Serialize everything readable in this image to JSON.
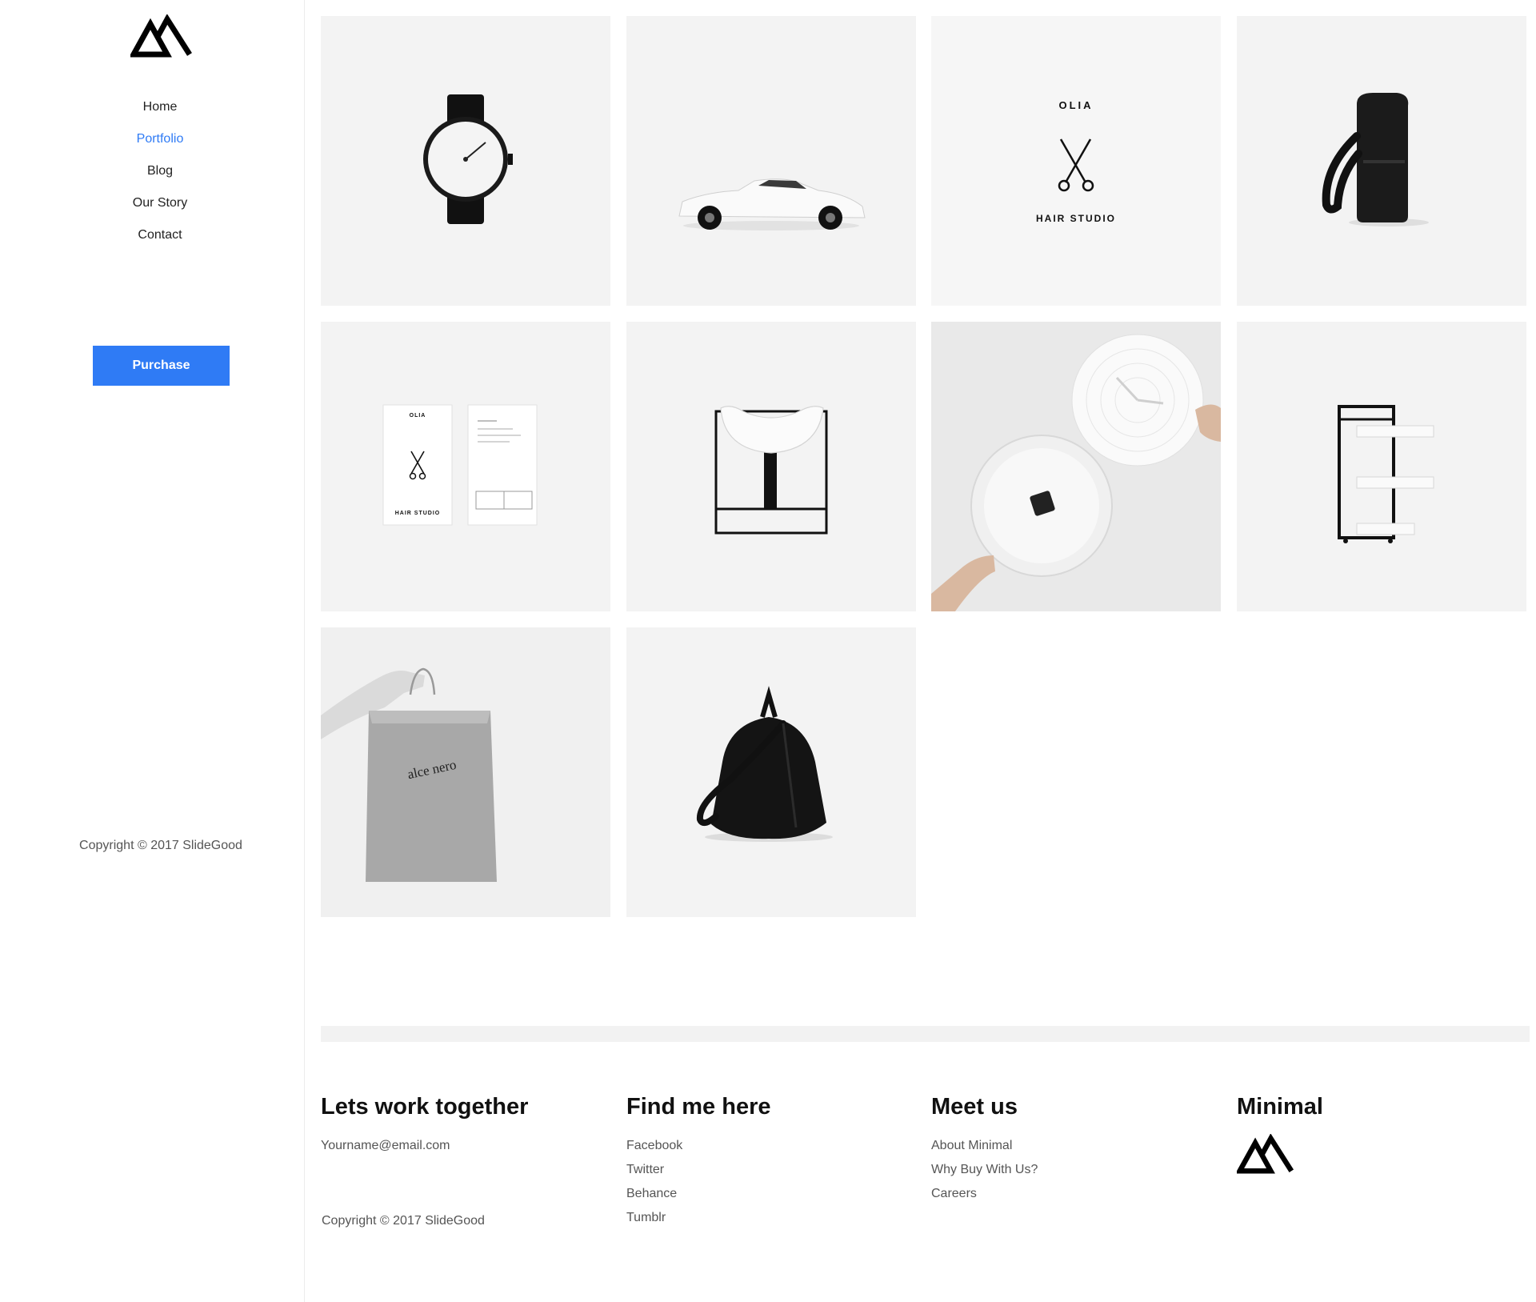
{
  "brand": {
    "name": "Minimal",
    "logo_icon": "mountain-logo-icon"
  },
  "nav": [
    {
      "label": "Home",
      "active": false
    },
    {
      "label": "Portfolio",
      "active": true
    },
    {
      "label": "Blog",
      "active": false
    },
    {
      "label": "Our Story",
      "active": false
    },
    {
      "label": "Contact",
      "active": false
    }
  ],
  "purchase_label": "Purchase",
  "sidebar_copyright": "Copyright © 2017 SlideGood",
  "portfolio": {
    "items": [
      {
        "name": "watch"
      },
      {
        "name": "white-sports-car"
      },
      {
        "name": "olia-hair-studio-logo",
        "brand": "OLIA",
        "tagline": "HAIR STUDIO"
      },
      {
        "name": "black-backpack"
      },
      {
        "name": "olia-business-cards",
        "brand": "OLIA",
        "tagline": "HAIR STUDIO"
      },
      {
        "name": "white-chair-steel-frame"
      },
      {
        "name": "wall-clock-in-hands"
      },
      {
        "name": "metal-shelf-cart"
      },
      {
        "name": "shopping-bag",
        "brand": "alce nero"
      },
      {
        "name": "black-leather-bag"
      }
    ]
  },
  "footer": {
    "col1": {
      "title": "Lets work together",
      "email": "Yourname@email.com",
      "copyright": "Copyright © 2017 SlideGood"
    },
    "col2": {
      "title": "Find me here",
      "links": [
        "Facebook",
        "Twitter",
        "Behance",
        "Tumblr"
      ]
    },
    "col3": {
      "title": "Meet us",
      "links": [
        "About Minimal",
        "Why Buy With Us?",
        "Careers"
      ]
    },
    "col4": {
      "title": "Minimal"
    }
  },
  "colors": {
    "accent": "#2f7bf5",
    "tile_bg": "#f3f3f3",
    "text": "#222222",
    "muted": "#555555"
  }
}
